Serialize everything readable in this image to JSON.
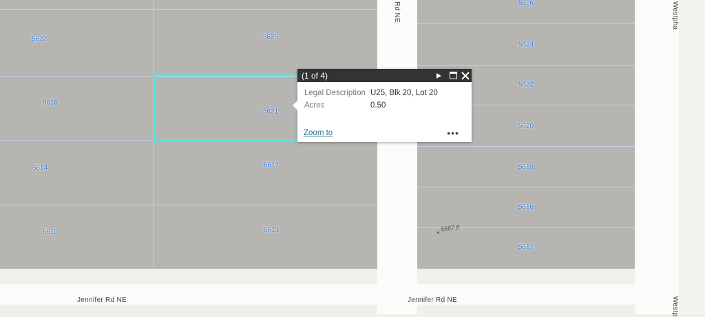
{
  "map": {
    "streets": {
      "south_left": "Jennifer Rd NE",
      "south_right": "Jennifer Rd NE",
      "north_south_top": "Rd NE",
      "east_top": "Westpha",
      "east_bottom": "Westp"
    },
    "parcels_left": [
      "5622",
      "5625",
      "5618",
      "5621",
      "5614",
      "5617",
      "5610",
      "5613"
    ],
    "parcels_right": [
      "5626",
      "5624",
      "5622",
      "5620",
      "5618",
      "5616",
      "5612"
    ],
    "elevation_label": "5667 ft",
    "selected_parcel": "5621"
  },
  "popup": {
    "counter": "(1 of 4)",
    "fields": [
      {
        "label": "Legal Description",
        "value": "U25, Blk 20, Lot 20"
      },
      {
        "label": "Acres",
        "value": "0.50"
      }
    ],
    "zoom_to": "Zoom to",
    "more": "•••"
  }
}
